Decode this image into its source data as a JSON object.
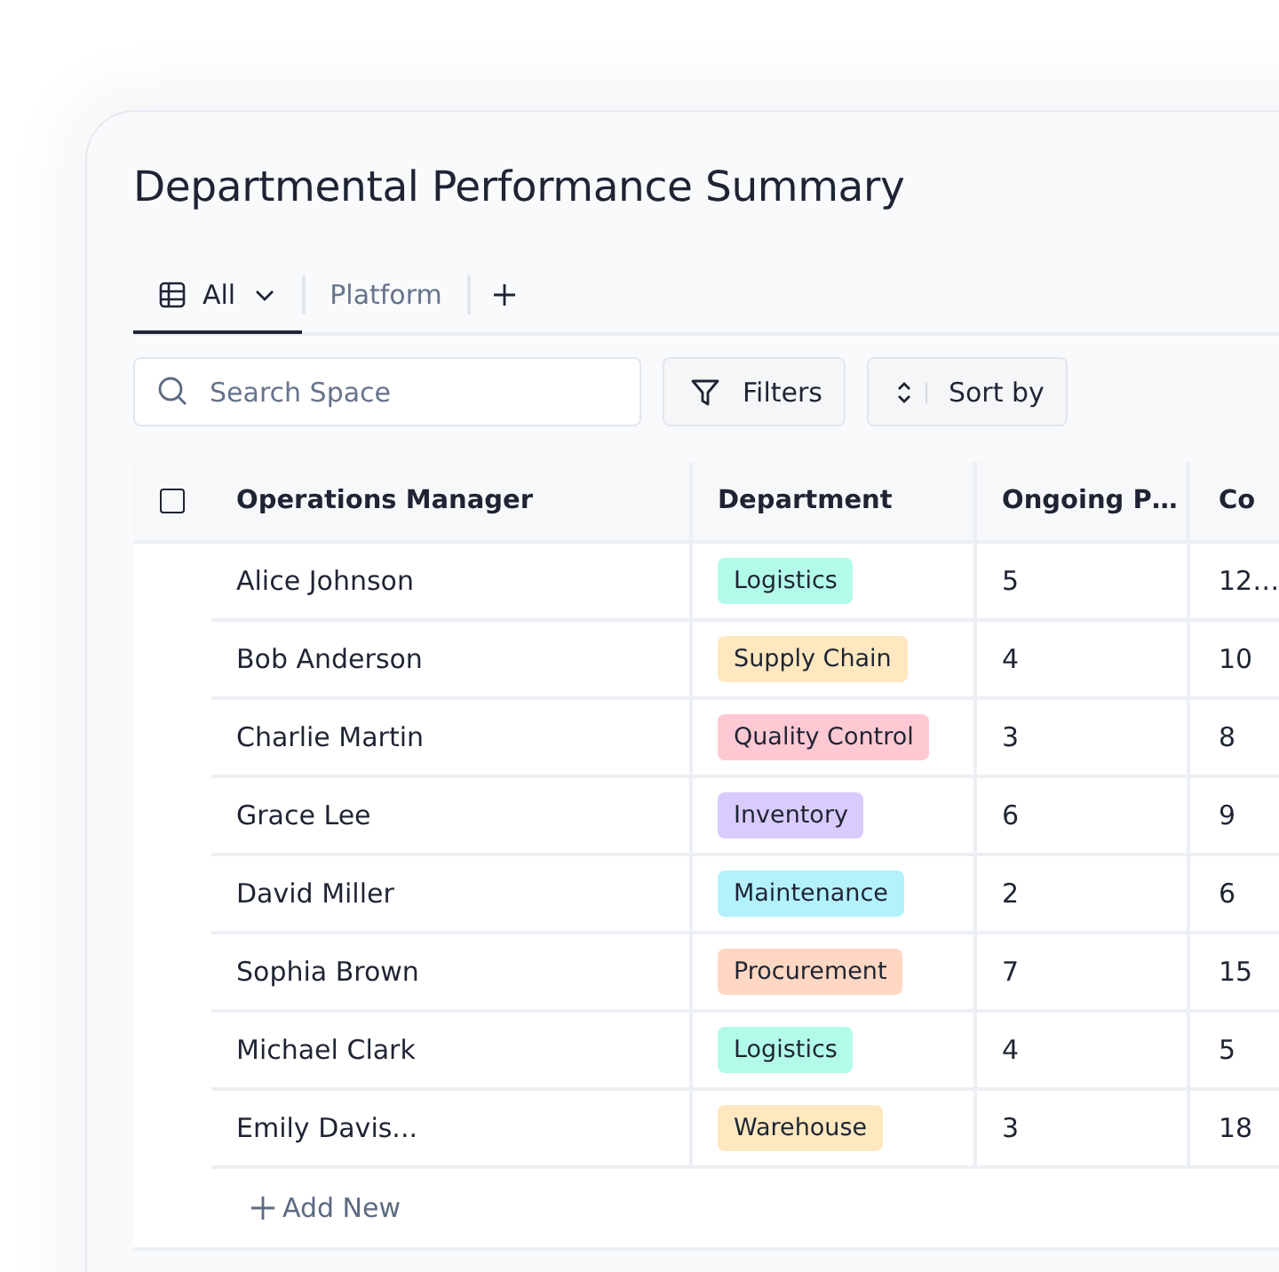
{
  "title": "Departmental Performance Summary",
  "tabs": [
    {
      "label": "All",
      "selected": true
    },
    {
      "label": "Platform",
      "selected": false
    }
  ],
  "search": {
    "placeholder": "Search Space"
  },
  "toolbar": {
    "filters": "Filters",
    "sort": "Sort by"
  },
  "table": {
    "select_all_checked": false,
    "columns": [
      "Operations Manager",
      "Department",
      "Ongoing P…",
      "Co"
    ],
    "rows": [
      {
        "manager": "Alice Johnson",
        "department": "Logistics",
        "color": "#b3fbe9",
        "ongoing": "5",
        "column_4": "12…"
      },
      {
        "manager": "Bob Anderson",
        "department": "Supply Chain",
        "color": "#ffe8bf",
        "ongoing": "4",
        "column_4": "10"
      },
      {
        "manager": "Charlie Martin",
        "department": "Quality Control",
        "color": "#ffc9d3",
        "ongoing": "3",
        "column_4": "8"
      },
      {
        "manager": "Grace Lee",
        "department": "Inventory",
        "color": "#d9cbfc",
        "ongoing": "6",
        "column_4": "9"
      },
      {
        "manager": "David Miller",
        "department": "Maintenance",
        "color": "#b3f1fd",
        "ongoing": "2",
        "column_4": "6"
      },
      {
        "manager": "Sophia Brown",
        "department": "Procurement",
        "color": "#ffd7c2",
        "ongoing": "7",
        "column_4": "15"
      },
      {
        "manager": "Michael Clark",
        "department": "Logistics",
        "color": "#b3fbe9",
        "ongoing": "4",
        "column_4": "5"
      },
      {
        "manager": "Emily Davis...",
        "department": "Warehouse",
        "color": "#ffe8bf",
        "ongoing": "3",
        "column_4": "18"
      }
    ],
    "add_new": "Add New"
  }
}
